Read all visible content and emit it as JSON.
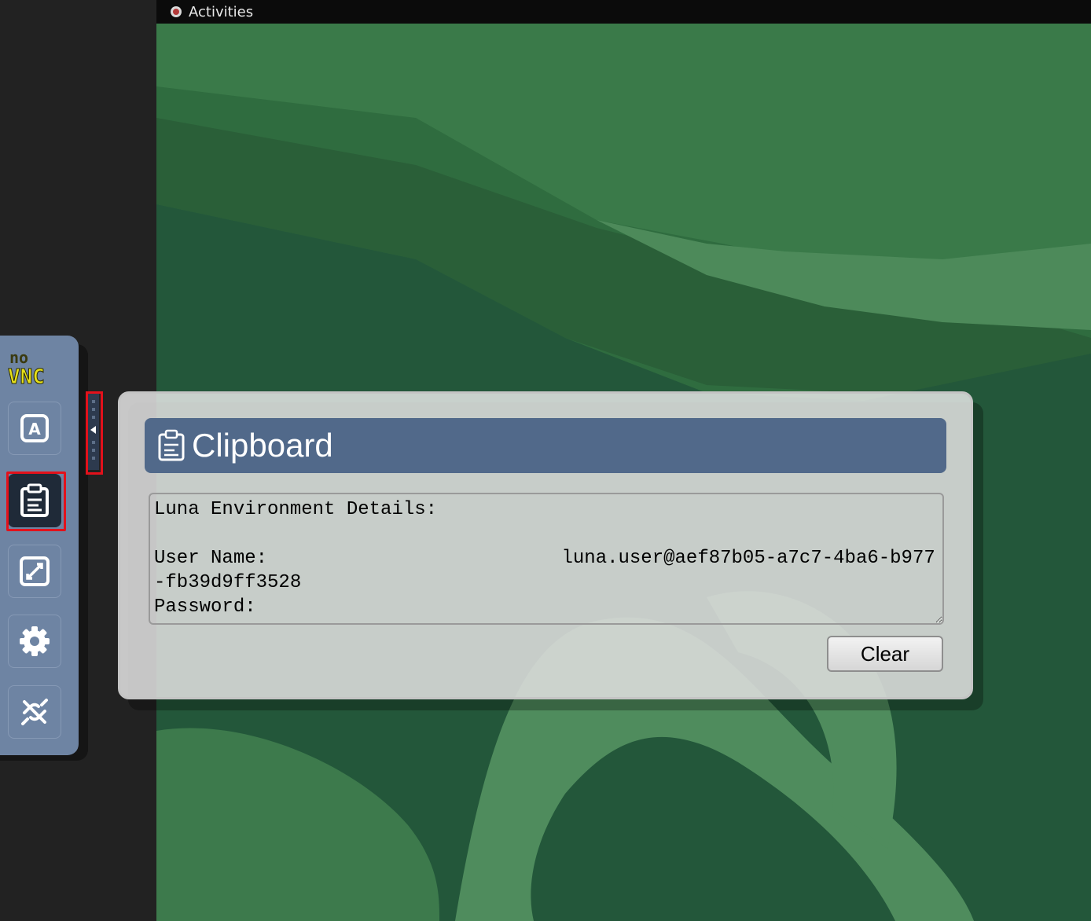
{
  "remote_desktop": {
    "topbar": {
      "activities_label": "Activities"
    }
  },
  "novnc_bar": {
    "logo_top": "no",
    "logo_bottom": "VNC",
    "buttons": [
      {
        "icon": "keyboard-icon",
        "glyph": "A"
      },
      {
        "icon": "clipboard-icon",
        "selected": true
      },
      {
        "icon": "fullscreen-icon"
      },
      {
        "icon": "settings-gear-icon"
      },
      {
        "icon": "disconnect-icon"
      }
    ]
  },
  "clipboard_panel": {
    "title": "Clipboard",
    "text_value": "Luna Environment Details:\n\nUser Name:                          luna.user@aef87b05-a7c7-4ba6-b977-fb39d9ff3528\nPassword:",
    "clear_label": "Clear"
  },
  "colors": {
    "control_bar": "#6e84a3",
    "panel_header": "#51698a",
    "highlight_outline": "#e3111b",
    "wallpaper_green": "#2f6b3e"
  }
}
